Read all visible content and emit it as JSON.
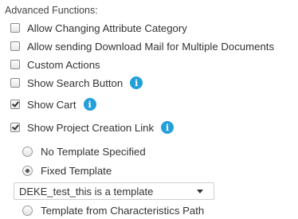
{
  "section_title": "Advanced Functions:",
  "options": [
    {
      "label": "Allow Changing Attribute Category",
      "checked": false
    },
    {
      "label": "Allow sending Download Mail for Multiple Documents",
      "checked": false
    },
    {
      "label": "Custom Actions",
      "checked": false
    },
    {
      "label": "Show Search Button",
      "checked": false,
      "info_icon": "info-icon"
    },
    {
      "label": "Show Cart",
      "checked": true,
      "info_icon": "info-icon"
    },
    {
      "label": "Show Project Creation Link",
      "checked": true,
      "info_icon": "info-icon"
    }
  ],
  "template_options": [
    {
      "label": "No Template Specified",
      "selected": false
    },
    {
      "label": "Fixed Template",
      "selected": true
    },
    {
      "label": "Template from Characteristics Path",
      "selected": false
    }
  ],
  "template_select": {
    "value": "DEKE_test_this is a template"
  },
  "info_icon_glyph": "i",
  "colors": {
    "info": "#23a0da",
    "text": "#333333"
  }
}
